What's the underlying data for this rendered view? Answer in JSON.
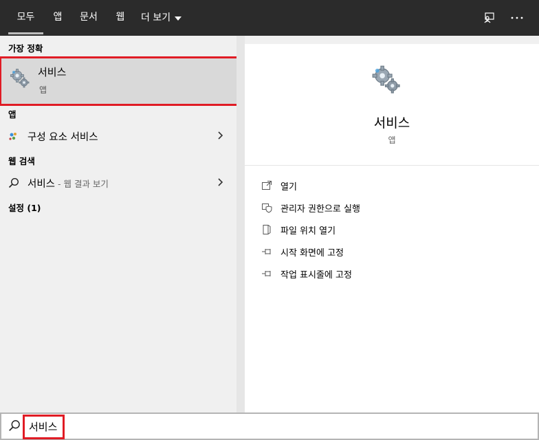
{
  "tabs": [
    {
      "label": "모두",
      "active": true
    },
    {
      "label": "앱"
    },
    {
      "label": "문서"
    },
    {
      "label": "웹"
    },
    {
      "label": "더 보기"
    }
  ],
  "top_icons": [
    "feedback-icon",
    "more-options-icon"
  ],
  "best_match": {
    "heading": "가장 정확",
    "title": "서비스",
    "subtitle": "앱",
    "icon": "gears-icon"
  },
  "apps": {
    "heading": "앱",
    "items": [
      {
        "label": "구성 요소 서비스",
        "icon": "component-services-icon"
      }
    ]
  },
  "web_search": {
    "heading": "웹 검색",
    "query": "서비스",
    "hint": " - 웹 결과 보기",
    "icon": "search-icon"
  },
  "settings": {
    "heading": "설정 (1)"
  },
  "detail": {
    "title": "서비스",
    "subtitle": "앱",
    "actions": [
      {
        "label": "열기",
        "icon": "open-icon"
      },
      {
        "label": "관리자 권한으로 실행",
        "icon": "shield-icon"
      },
      {
        "label": "파일 위치 열기",
        "icon": "file-location-icon"
      },
      {
        "label": "시작 화면에 고정",
        "icon": "pin-icon"
      },
      {
        "label": "작업 표시줄에 고정",
        "icon": "pin-icon"
      }
    ]
  },
  "search": {
    "value": "서비스",
    "icon": "search-icon"
  },
  "colors": {
    "highlight": "#e01b24",
    "topbar": "#2b2b2b",
    "selected_row": "#d9d9d9"
  }
}
